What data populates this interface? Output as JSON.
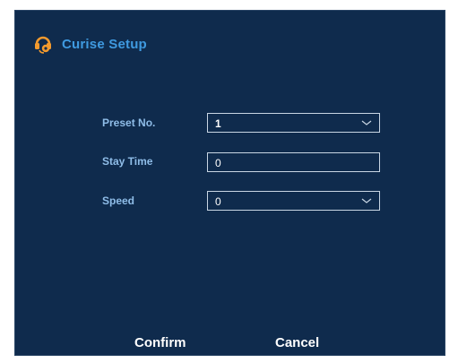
{
  "dialog": {
    "title": "Curise Setup",
    "title_icon": "camera-settings-icon",
    "accent_color": "#3f9ae0"
  },
  "form": {
    "preset_no": {
      "label": "Preset No.",
      "value": "1"
    },
    "stay_time": {
      "label": "Stay Time",
      "value": "0"
    },
    "speed": {
      "label": "Speed",
      "value": "0"
    }
  },
  "actions": {
    "confirm_label": "Confirm",
    "cancel_label": "Cancel"
  }
}
